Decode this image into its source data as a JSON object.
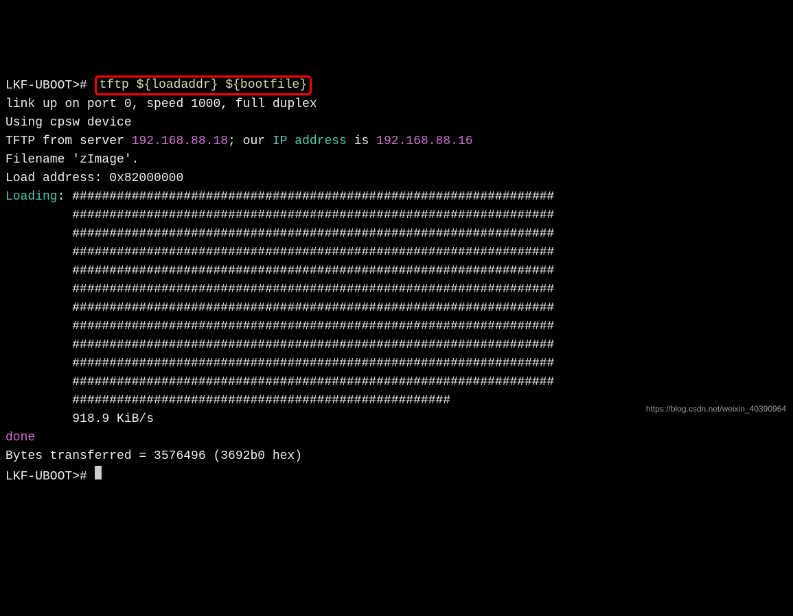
{
  "terminal": {
    "prompt": "LKF-UBOOT>#",
    "command": {
      "cmd": "tftp",
      "arg1": "${loadaddr}",
      "arg2": "${bootfile}"
    },
    "line_link": "link up on port 0, speed 1000, full duplex",
    "line_device": "Using cpsw device",
    "tftp_prefix": "TFTP from server ",
    "server_ip": "192.168.88.18",
    "tftp_mid": "; our ",
    "ip_addr_label": "IP address",
    "tftp_mid2": " is ",
    "our_ip": "192.168.88.16",
    "line_filename": "Filename 'zImage'.",
    "line_loadaddr": "Load address: 0x82000000",
    "loading_label": "Loading",
    "loading_colon": ": ",
    "hash_row": "#################################################################",
    "hash_row_last": "###################################################",
    "speed_line": "         918.9 KiB/s",
    "done_label": "done",
    "bytes_line": "Bytes transferred = 3576496 (3692b0 hex)",
    "watermark": "https://blog.csdn.net/weixin_40390964"
  }
}
